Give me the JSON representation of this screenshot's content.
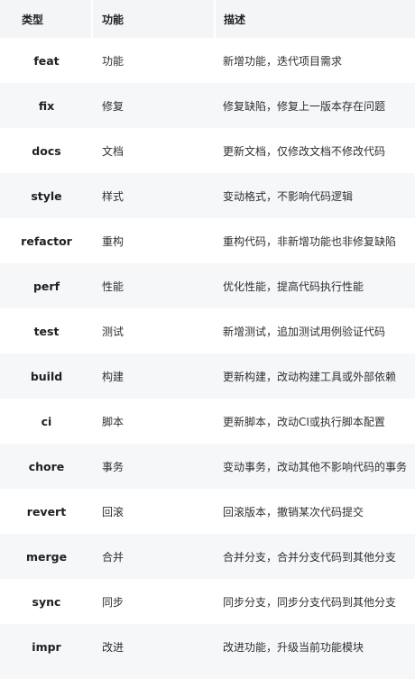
{
  "headers": {
    "type": "类型",
    "function": "功能",
    "description": "描述"
  },
  "rows": [
    {
      "type": "feat",
      "function": "功能",
      "description": "新增功能，迭代项目需求"
    },
    {
      "type": "fix",
      "function": "修复",
      "description": "修复缺陷，修复上一版本存在问题"
    },
    {
      "type": "docs",
      "function": "文档",
      "description": "更新文档，仅修改文档不修改代码"
    },
    {
      "type": "style",
      "function": "样式",
      "description": "变动格式，不影响代码逻辑"
    },
    {
      "type": "refactor",
      "function": "重构",
      "description": "重构代码，非新增功能也非修复缺陷"
    },
    {
      "type": "perf",
      "function": "性能",
      "description": "优化性能，提高代码执行性能"
    },
    {
      "type": "test",
      "function": "测试",
      "description": "新增测试，追加测试用例验证代码"
    },
    {
      "type": "build",
      "function": "构建",
      "description": "更新构建，改动构建工具或外部依赖"
    },
    {
      "type": "ci",
      "function": "脚本",
      "description": "更新脚本，改动CI或执行脚本配置"
    },
    {
      "type": "chore",
      "function": "事务",
      "description": "变动事务，改动其他不影响代码的事务"
    },
    {
      "type": "revert",
      "function": "回滚",
      "description": "回滚版本，撤销某次代码提交"
    },
    {
      "type": "merge",
      "function": "合并",
      "description": "合并分支，合并分支代码到其他分支"
    },
    {
      "type": "sync",
      "function": "同步",
      "description": "同步分支，同步分支代码到其他分支"
    },
    {
      "type": "impr",
      "function": "改进",
      "description": "改进功能，升级当前功能模块"
    }
  ]
}
